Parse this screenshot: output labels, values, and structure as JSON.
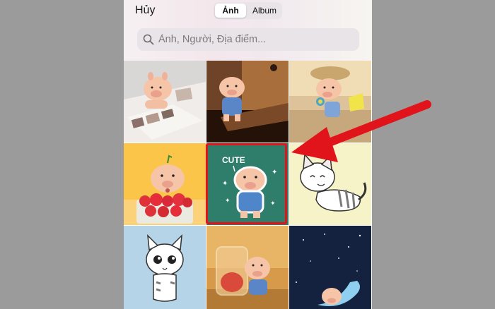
{
  "header": {
    "cancel_label": "Hủy",
    "tabs": [
      {
        "label": "Ảnh",
        "active": true
      },
      {
        "label": "Album",
        "active": false
      }
    ]
  },
  "search": {
    "placeholder": "Ảnh, Người, Địa điểm...",
    "icon": "search-icon"
  },
  "photos": [
    {
      "subject": "pig-on-photo-album"
    },
    {
      "subject": "pig-in-drawer"
    },
    {
      "subject": "pig-with-lollipop"
    },
    {
      "subject": "pig-with-strawberries"
    },
    {
      "subject": "pig-cute-sticker",
      "selected": true,
      "text": "CUTE"
    },
    {
      "subject": "cat-lying-down"
    },
    {
      "subject": "cartoon-cat"
    },
    {
      "subject": "pig-with-jar"
    },
    {
      "subject": "pig-on-moon"
    }
  ],
  "annotation": {
    "color": "#e1141c",
    "type": "red-arrow-and-box"
  }
}
